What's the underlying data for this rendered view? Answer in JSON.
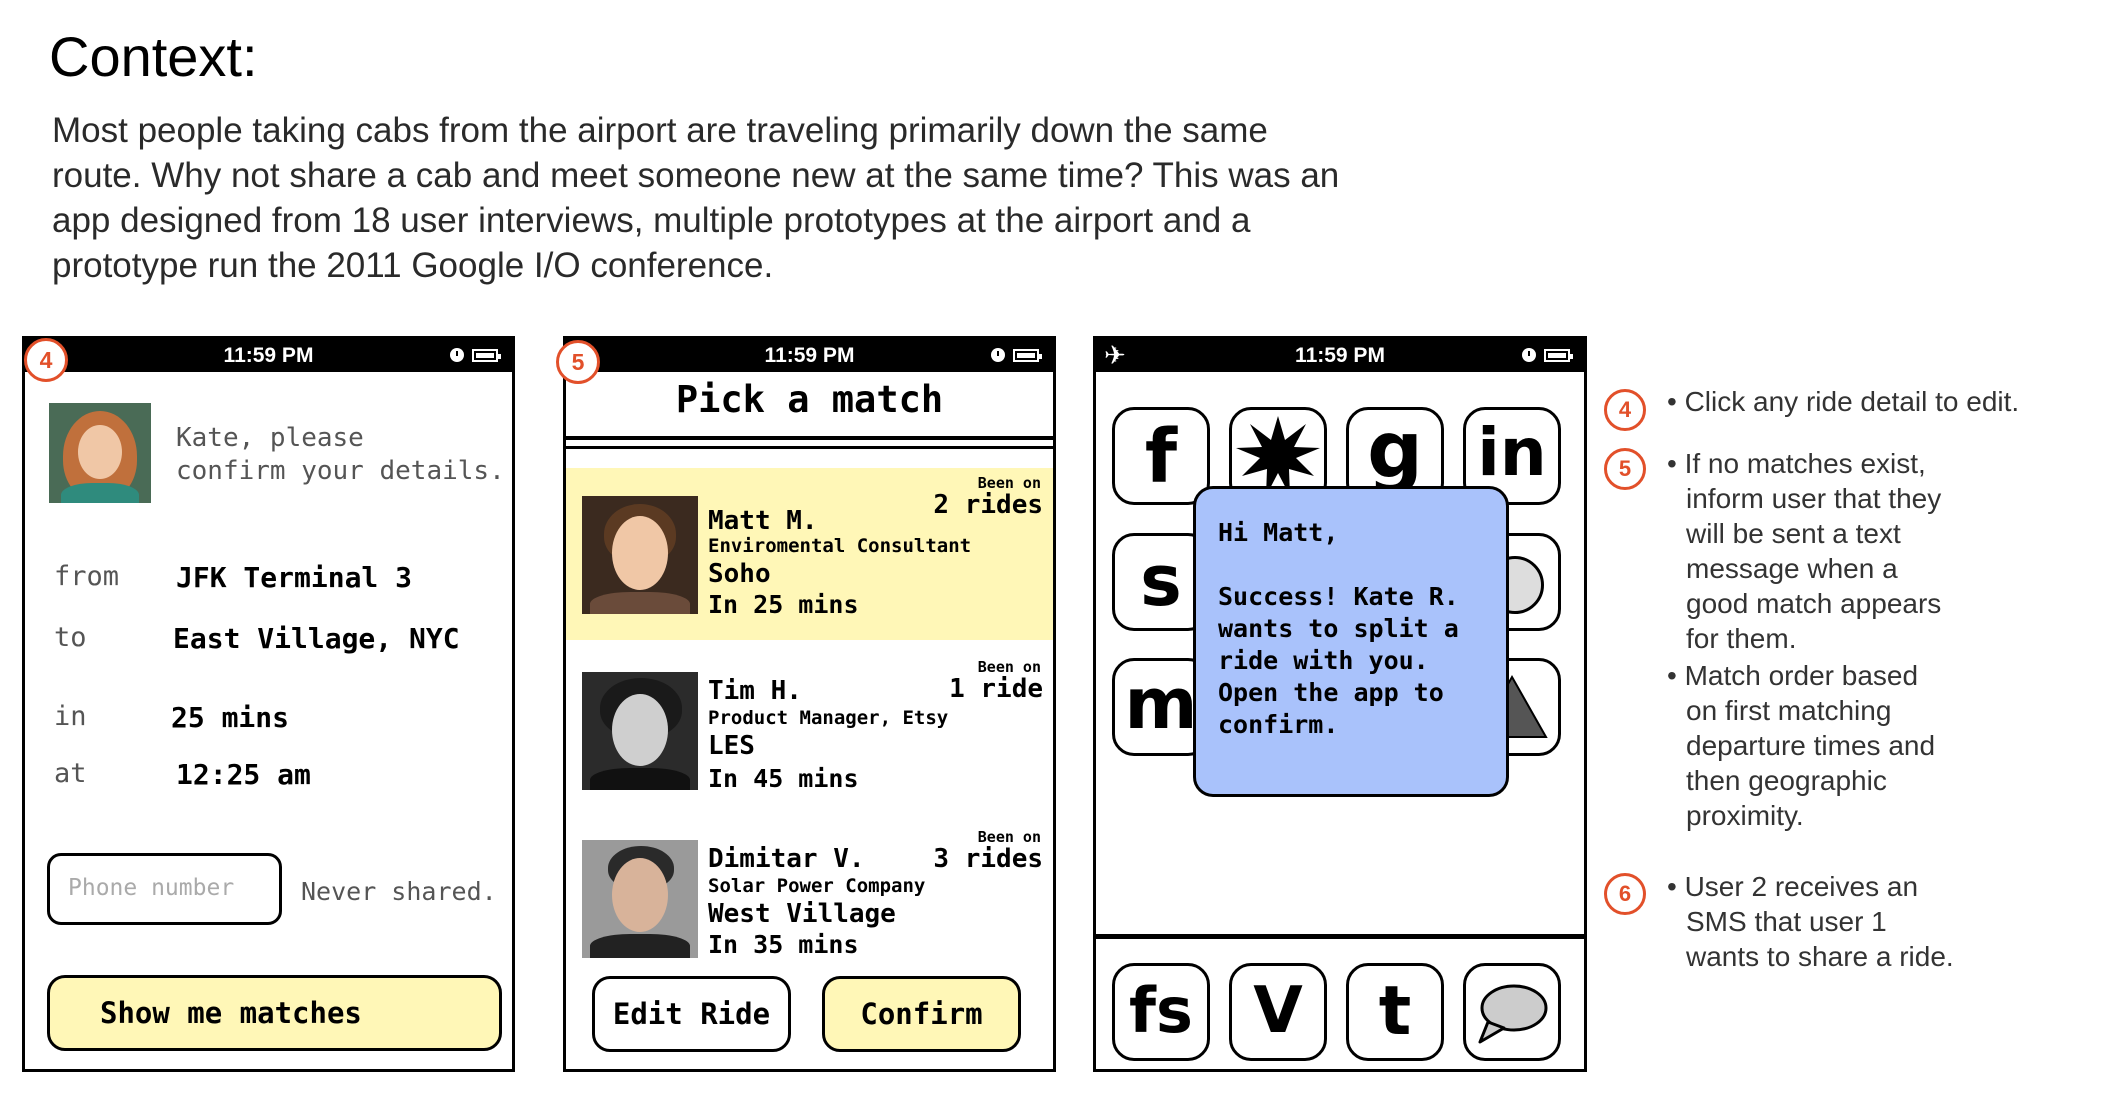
{
  "context": {
    "title": "Context:",
    "lines": [
      "Most people taking cabs from the airport are traveling primarily down the same",
      "route. Why not share a cab and meet someone new at the same time? This was an",
      "app designed from 18 user interviews, multiple prototypes at the airport and a",
      "prototype run the 2011 Google I/O conference."
    ]
  },
  "status_time": "11:59 PM",
  "screen1": {
    "badge": "4",
    "greeting_line1": "Kate, please",
    "greeting_line2": "confirm your details.",
    "from_label": "from",
    "from_value": "JFK Terminal 3",
    "to_label": "to",
    "to_value": "East Village, NYC",
    "in_label": "in",
    "in_value": "25 mins",
    "at_label": "at",
    "at_value": "12:25 am",
    "phone_placeholder": "Phone number",
    "never_shared": "Never shared.",
    "show_matches_button": "Show me matches"
  },
  "screen2": {
    "badge": "5",
    "title": "Pick a match",
    "matches": [
      {
        "name": "Matt M.",
        "role": "Enviromental Consultant",
        "area": "Soho",
        "eta": "In 25 mins",
        "been_on": "Been on",
        "rides": "2 rides"
      },
      {
        "name": "Tim H.",
        "role": "Product Manager, Etsy",
        "area": "LES",
        "eta": "In 45 mins",
        "been_on": "Been on",
        "rides": "1 ride"
      },
      {
        "name": "Dimitar V.",
        "role": "Solar Power Company",
        "area": "West Village",
        "eta": "In 35 mins",
        "been_on": "Been on",
        "rides": "3 rides"
      }
    ],
    "edit_button": "Edit Ride",
    "confirm_button": "Confirm"
  },
  "screen3": {
    "apps_row1": [
      "f",
      "g",
      "in"
    ],
    "app_s": "s",
    "app_m": "m",
    "dock": [
      "fs",
      "V",
      "t"
    ],
    "sms_text": "Hi Matt,\n\nSuccess! Kate R.\nwants to split a\nride with you.\nOpen the app to\nconfirm."
  },
  "notes": {
    "n4": {
      "badge": "4",
      "lines": [
        "• Click any ride detail to edit."
      ]
    },
    "n5": {
      "badge": "5",
      "lines": [
        "• If no matches exist,",
        "inform user that they",
        "will be sent a text",
        "message when a",
        "good match appears",
        "for them.",
        "• Match order based",
        "on first matching",
        "departure times and",
        "then geographic",
        "proximity."
      ]
    },
    "n6": {
      "badge": "6",
      "lines": [
        "• User 2 receives an",
        "SMS that user 1",
        "wants to share a ride."
      ]
    }
  },
  "colors": {
    "accent": "#e2502a",
    "highlight": "#fff7b7",
    "sms": "#a9c2fb"
  }
}
